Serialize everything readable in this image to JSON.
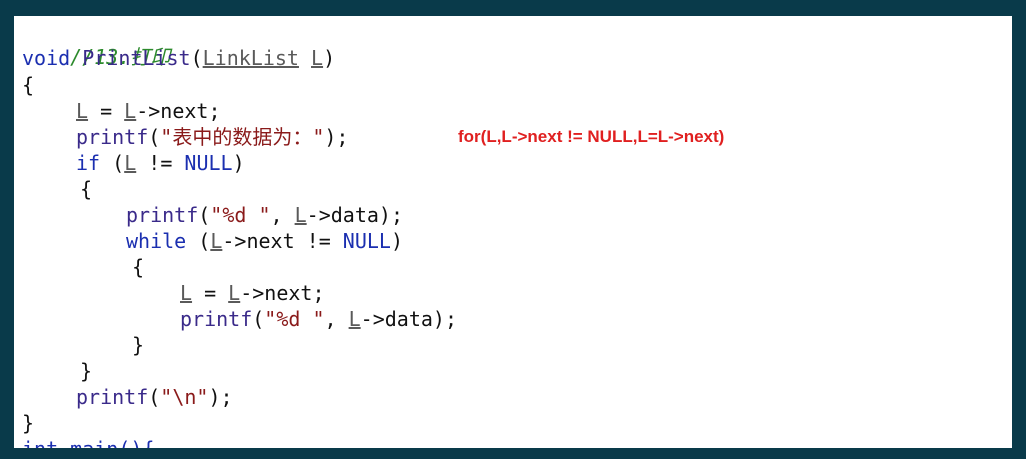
{
  "code": {
    "comment": "//13.打印",
    "l2": {
      "kw": "void",
      "fn": "PrintList",
      "p1": "(",
      "type": "LinkList",
      "sp": " ",
      "param": "L",
      "p2": ")"
    },
    "l3": "{",
    "l4": {
      "a": "L",
      "b": " = ",
      "c": "L",
      "d": "->next;"
    },
    "l5": {
      "fn": "printf",
      "a": "(",
      "s": "\"表中的数据为：\"",
      "b": ");"
    },
    "l6": {
      "kw": "if",
      "a": " (",
      "v": "L",
      "b": " != ",
      "n": "NULL",
      "c": ")"
    },
    "l7": "{",
    "l8": {
      "fn": "printf",
      "a": "(",
      "s": "\"%d \"",
      "b": ", ",
      "v": "L",
      "c": "->data);"
    },
    "l9": {
      "kw": "while",
      "a": " (",
      "v": "L",
      "b": "->next != ",
      "n": "NULL",
      "c": ")"
    },
    "l10": "{",
    "l11": {
      "a": "L",
      "b": " = ",
      "c": "L",
      "d": "->next;"
    },
    "l12": {
      "fn": "printf",
      "a": "(",
      "s": "\"%d \"",
      "b": ", ",
      "v": "L",
      "c": "->data);"
    },
    "l13": "}",
    "l14": "}",
    "l15": {
      "fn": "printf",
      "a": "(",
      "s": "\"\\n\"",
      "b": ");"
    },
    "l16": "}",
    "l17": "int main(){"
  },
  "annotation": "for(L,L->next != NULL,L=L->next)"
}
